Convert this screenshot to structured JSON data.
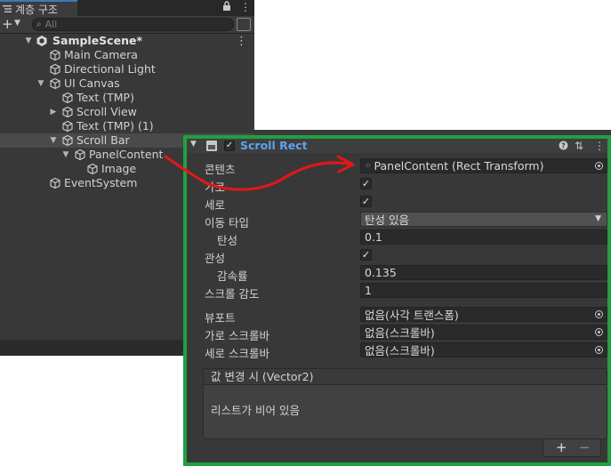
{
  "hierarchy": {
    "tab_title": "계층 구조",
    "lock_icon": "lock-icon",
    "menu_icon": "kebab-menu-icon",
    "add_label": "+",
    "search_placeholder": "All",
    "items": [
      {
        "label": "SampleScene*",
        "depth": 0,
        "expanded": true,
        "kind": "scene"
      },
      {
        "label": "Main Camera",
        "depth": 1,
        "kind": "object"
      },
      {
        "label": "Directional Light",
        "depth": 1,
        "kind": "object"
      },
      {
        "label": "UI Canvas",
        "depth": 1,
        "expanded": true,
        "kind": "object"
      },
      {
        "label": "Text (TMP)",
        "depth": 2,
        "kind": "object"
      },
      {
        "label": "Scroll View",
        "depth": 2,
        "expanded": false,
        "kind": "object"
      },
      {
        "label": "Text (TMP) (1)",
        "depth": 2,
        "kind": "object"
      },
      {
        "label": "Scroll Bar",
        "depth": 2,
        "expanded": true,
        "kind": "object",
        "selected": true
      },
      {
        "label": "PanelContent",
        "depth": 3,
        "expanded": true,
        "kind": "object"
      },
      {
        "label": "Image",
        "depth": 4,
        "kind": "object"
      },
      {
        "label": "EventSystem",
        "depth": 1,
        "kind": "object"
      }
    ]
  },
  "inspector": {
    "component_title": "Scroll Rect",
    "component_enabled": true,
    "help_icon": "help-icon",
    "preset_icon": "preset-icon",
    "menu_icon": "kebab-menu-icon",
    "props": {
      "content_label": "콘텐츠",
      "content_value": "PanelContent (Rect Transform)",
      "horizontal_label": "가로",
      "horizontal_checked": true,
      "vertical_label": "세로",
      "vertical_checked": true,
      "movement_label": "이동 타입",
      "movement_value": "탄성 있음",
      "elasticity_label": "탄성",
      "elasticity_value": "0.1",
      "inertia_label": "관성",
      "inertia_checked": true,
      "decel_label": "감속률",
      "decel_value": "0.135",
      "sensitivity_label": "스크롤 감도",
      "sensitivity_value": "1",
      "viewport_label": "뷰포트",
      "viewport_value": "없음(사각 트랜스폼)",
      "hscroll_label": "가로 스크롤바",
      "hscroll_value": "없음(스크롤바)",
      "vscroll_label": "세로 스크롤바",
      "vscroll_value": "없음(스크롤바)"
    },
    "event": {
      "header": "값 변경 시 (Vector2)",
      "empty_text": "리스트가 비어 있음",
      "add_label": "+",
      "remove_label": "−"
    }
  },
  "colors": {
    "highlight_border": "#20a040",
    "annotation_arrow": "#e01818",
    "component_title": "#5ea2ef"
  }
}
